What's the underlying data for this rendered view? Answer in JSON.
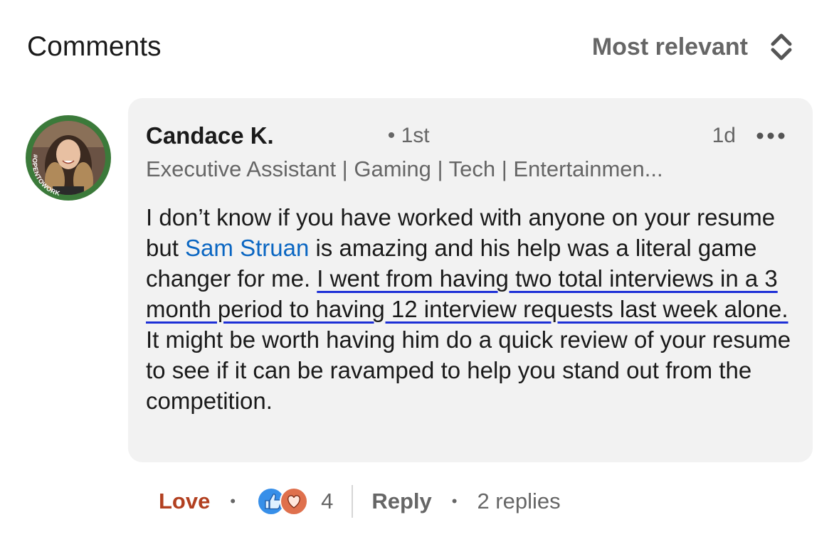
{
  "header": {
    "title": "Comments",
    "sort_label": "Most relevant"
  },
  "comment": {
    "author": "Candace K.",
    "degree": "• 1st",
    "time": "1d",
    "headline": "Executive Assistant | Gaming | Tech | Entertainmen...",
    "avatar_badge": "#OPENTOWORK",
    "body": {
      "part1": "I don’t know if you have worked with anyone on your resume but ",
      "mention": "Sam Struan",
      "part2": " is amazing and his help was a literal game changer for me. ",
      "highlight": "I went from having two total interviews in a 3 month period to having 12 interview requests last week alone.",
      "part3": " It might be worth having him do a quick review of your resume to see if it can be ravamped to help you stand out from the competition."
    }
  },
  "actions": {
    "love_label": "Love",
    "reaction_count": "4",
    "reply_label": "Reply",
    "replies_label": "2 replies",
    "separator": "•"
  },
  "colors": {
    "mention": "#0a66c2",
    "love": "#b24020",
    "highlight_underline": "#1d2fd6",
    "bubble_bg": "#f2f2f2",
    "opentowork_ring": "#3b7a3a"
  },
  "icons": {
    "sort": "chevron-up-down-icon",
    "more": "more-horizontal-icon",
    "reactions": [
      "like-reaction-icon",
      "love-reaction-icon"
    ]
  }
}
